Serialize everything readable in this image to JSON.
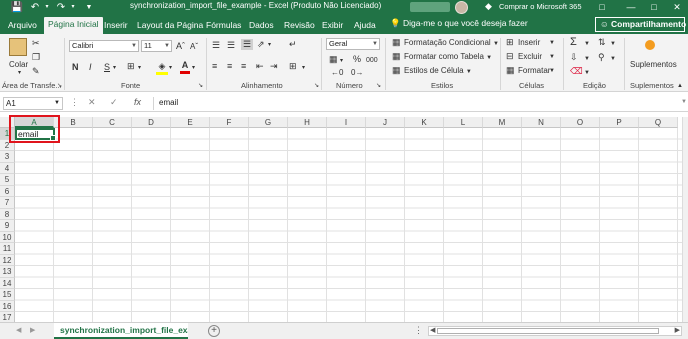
{
  "window": {
    "title": "synchronization_import_file_example  -  Excel (Produto Não Licenciado)",
    "buy_label": "Comprar o Microsoft 365",
    "icons": [
      "save-icon",
      "undo-icon",
      "redo-icon",
      "customize-icon",
      "buy-icon",
      "restore-icon",
      "minimize-icon",
      "maximize-icon",
      "close-icon"
    ]
  },
  "tabs": [
    "Arquivo",
    "Página Inicial",
    "Inserir",
    "Layout da Página",
    "Fórmulas",
    "Dados",
    "Revisão",
    "Exibir",
    "Ajuda"
  ],
  "active_tab": "Página Inicial",
  "tell_me": "Diga-me o que você deseja fazer",
  "share_label": "Compartilhamento",
  "ribbon": {
    "clipboard": {
      "paste": "Colar",
      "label": "Área de Transfe..."
    },
    "font": {
      "name": "Calibri",
      "size": "11",
      "bold": "N",
      "italic": "I",
      "underline": "S",
      "color_letter": "A",
      "label": "Fonte"
    },
    "alignment": {
      "label": "Alinhamento"
    },
    "number": {
      "format": "Geral",
      "percent": "%",
      "thousands": "000",
      "label": "Número"
    },
    "styles": {
      "conditional": "Formatação Condicional",
      "as_table": "Formatar como Tabela",
      "cell_styles": "Estilos de Célula",
      "label": "Estilos"
    },
    "cells": {
      "insert": "Inserir",
      "delete": "Excluir",
      "format": "Formatar",
      "label": "Células"
    },
    "editing": {
      "label": "Edição"
    },
    "addins": {
      "addins": "Suplementos",
      "label": "Suplementos"
    },
    "colors": {
      "fill": "#ffff00",
      "font": "#e00000",
      "accent": "#217346",
      "highlight": "#e0141c"
    }
  },
  "formula_bar": {
    "name_box": "A1",
    "fx": "fx",
    "content": "email"
  },
  "grid": {
    "columns": [
      "A",
      "B",
      "C",
      "D",
      "E",
      "F",
      "G",
      "H",
      "I",
      "J",
      "K",
      "L",
      "M",
      "N",
      "O",
      "P",
      "Q"
    ],
    "rows": [
      "1",
      "2",
      "3",
      "4",
      "5",
      "6",
      "7",
      "8",
      "9",
      "10",
      "11",
      "12",
      "13",
      "14",
      "15",
      "16",
      "17"
    ],
    "cells": {
      "A1": "email"
    },
    "selected_cell": "A1"
  },
  "sheet_tab": "synchronization_import_file_exa"
}
